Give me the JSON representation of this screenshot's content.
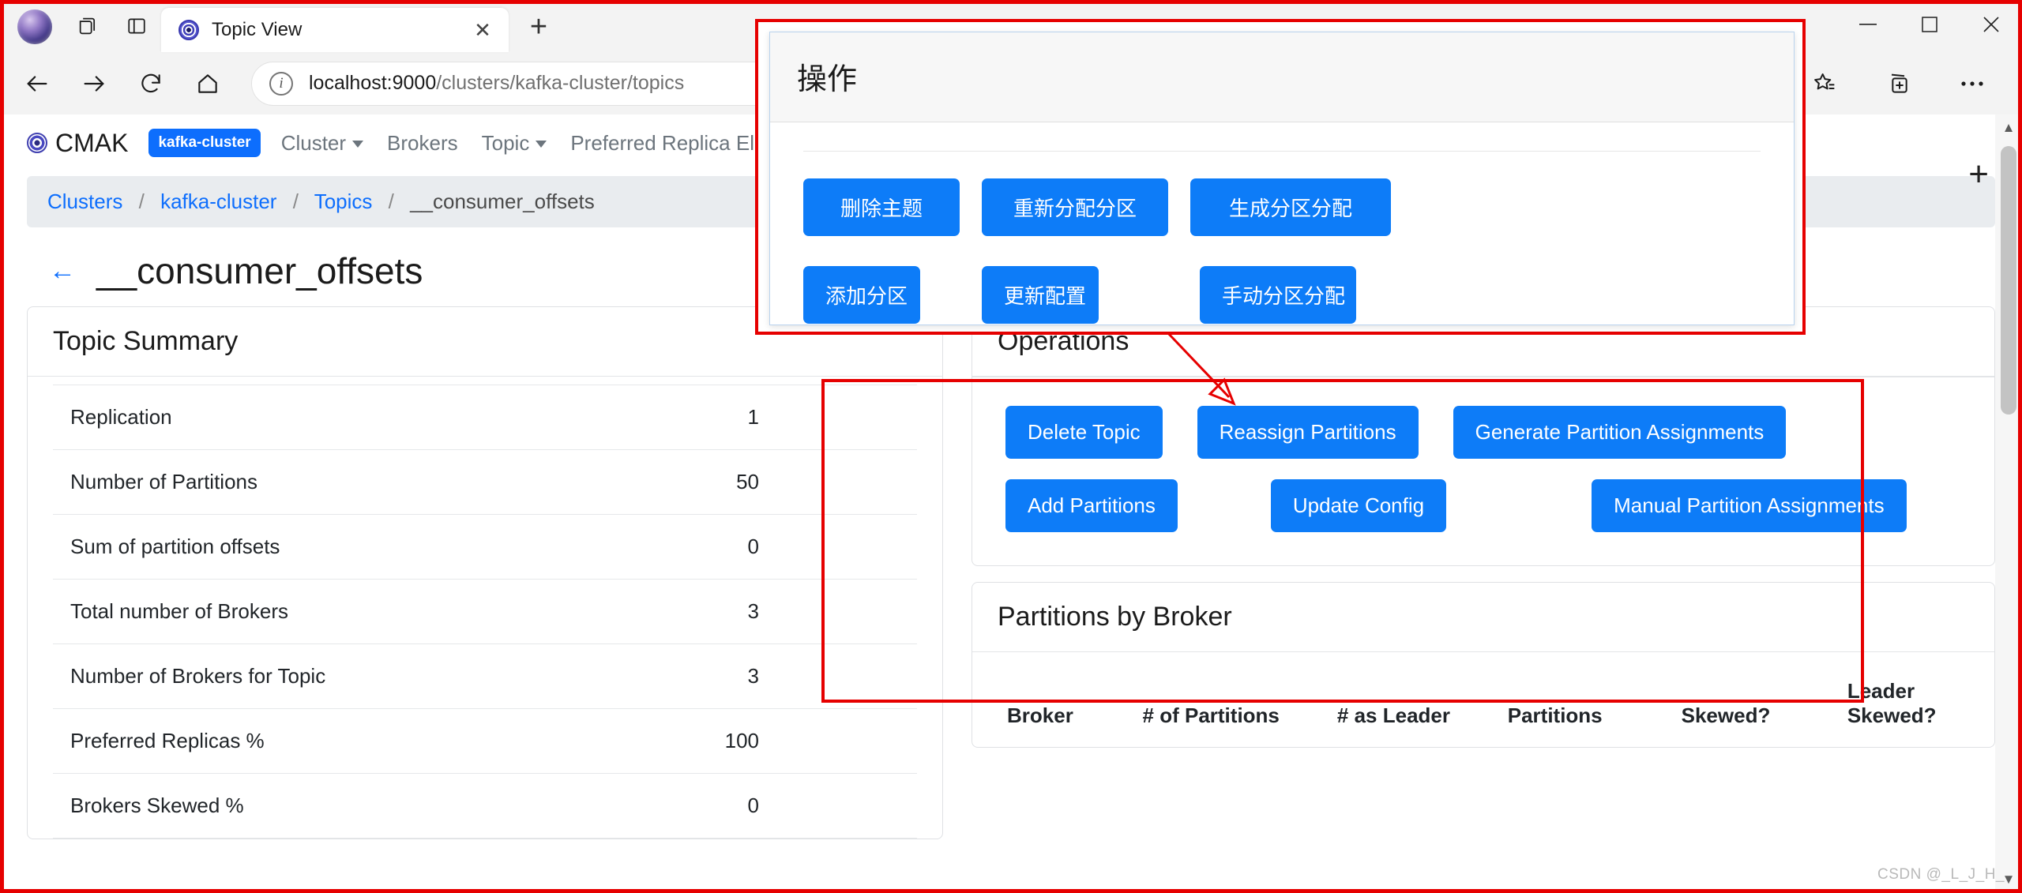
{
  "browser": {
    "tab": {
      "title": "Topic View",
      "favicon_name": "cmak-favicon",
      "close_label": "✕"
    },
    "new_tab_label": "+",
    "window_controls": {
      "minimize": "—",
      "maximize": "☐",
      "close": "✕"
    },
    "url": {
      "host": "localhost:9000",
      "path": "/clusters/kafka-cluster/topics",
      "full": "localhost:9000/clusters/kafka-cluster/topics"
    },
    "toolbar_icons": [
      "back-icon",
      "forward-icon",
      "refresh-icon",
      "home-icon",
      "split-screen-icon",
      "favorites-icon",
      "collections-icon",
      "settings-more-icon"
    ]
  },
  "cmak": {
    "brand": "CMAK",
    "cluster_badge": "kafka-cluster",
    "nav_items": [
      {
        "label": "Cluster",
        "has_caret": true
      },
      {
        "label": "Brokers",
        "has_caret": false
      },
      {
        "label": "Topic",
        "has_caret": true
      },
      {
        "label": "Preferred Replica Election",
        "has_caret": false
      }
    ],
    "breadcrumb": {
      "items": [
        "Clusters",
        "kafka-cluster",
        "Topics"
      ],
      "current": "__consumer_offsets",
      "separator": "/"
    },
    "page_title": "__consumer_offsets",
    "back_arrow": "←"
  },
  "topic_summary": {
    "title": "Topic Summary",
    "rows": [
      {
        "label": "Replication",
        "value": "1"
      },
      {
        "label": "Number of Partitions",
        "value": "50"
      },
      {
        "label": "Sum of partition offsets",
        "value": "0"
      },
      {
        "label": "Total number of Brokers",
        "value": "3"
      },
      {
        "label": "Number of Brokers for Topic",
        "value": "3"
      },
      {
        "label": "Preferred Replicas %",
        "value": "100"
      },
      {
        "label": "Brokers Skewed %",
        "value": "0"
      }
    ]
  },
  "operations": {
    "title": "Operations",
    "buttons_row1": [
      "Delete Topic",
      "Reassign Partitions",
      "Generate Partition Assignments"
    ],
    "buttons_row2": [
      "Add Partitions",
      "Update Config",
      "Manual Partition Assignments"
    ]
  },
  "partitions_by_broker": {
    "title": "Partitions by Broker",
    "columns": [
      "Broker",
      "# of Partitions",
      "# as Leader",
      "Partitions",
      "Skewed?",
      "Leader Skewed?"
    ]
  },
  "zh_dialog": {
    "title": "操作",
    "buttons_row1": [
      "删除主题",
      "重新分配分区",
      "生成分区分配"
    ],
    "buttons_row2": [
      "添加分区",
      "更新配置",
      "手动分区分配"
    ]
  },
  "annotation": {
    "highlight_color": "#e60000",
    "arrow_name": "callout-arrow"
  },
  "watermark": "CSDN @_L_J_H_",
  "colors": {
    "primary_blue": "#0d7cf8",
    "link_blue": "#0d6efd",
    "badge_blue": "#0d6efd",
    "annotation_red": "#e60000",
    "muted_gray": "#6c757d"
  }
}
